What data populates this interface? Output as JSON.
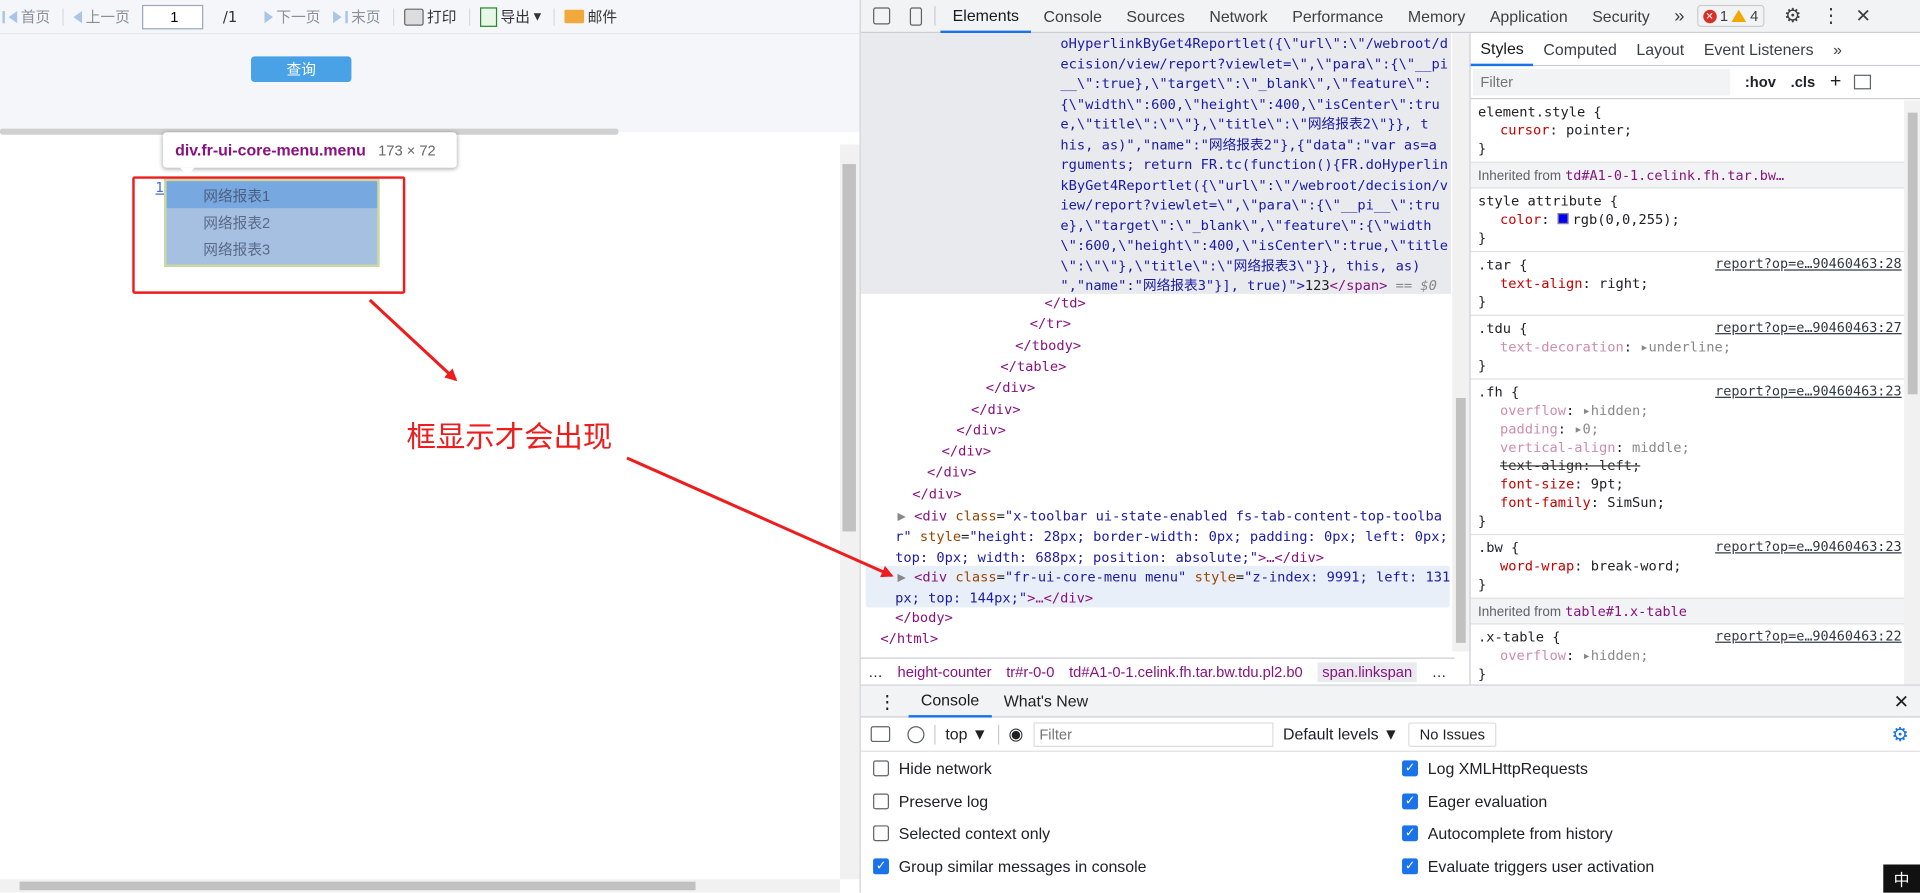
{
  "report_toolbar": {
    "first_page": "首页",
    "prev_page": "上一页",
    "page_value": "1",
    "page_total": "/1",
    "next_page": "下一页",
    "last_page": "末页",
    "print": "打印",
    "export": "导出",
    "mail": "邮件"
  },
  "query": {
    "button": "查询"
  },
  "tooltip": {
    "selector_tag": "div",
    "selector_class": ".fr-ui-core-menu.menu",
    "size": "173 × 72"
  },
  "report": {
    "cell_link": "1",
    "menu_items": [
      "网络报表1",
      "网络报表2",
      "网络报表3"
    ]
  },
  "annotation": {
    "text": "框显示才会出现"
  },
  "devtools": {
    "tabs": [
      "Elements",
      "Console",
      "Sources",
      "Network",
      "Performance",
      "Memory",
      "Application",
      "Security"
    ],
    "active_tab": "Elements",
    "more": "»",
    "errors": "1",
    "warnings": "4",
    "code_lines": [
      "oHyperlinkByGet4Reportlet({\\\"url\\\":\\\"/webroot/d",
      "ecision/view/report?viewlet=\\\",\\\"para\\\":{\\\"__pi",
      "__\\\":true},\\\"target\\\":\\\"_blank\\\",\\\"feature\\\":",
      "{\\\"width\\\":600,\\\"height\\\":400,\\\"isCenter\\\":tru",
      "e,\\\"title\\\":\\\"\\\"},\\\"title\\\":\\\"网络报表2\\\"}}, t",
      "his, as)\",\"name\":\"网络报表2\"},{\"data\":\"var as=a",
      "rguments; return FR.tc(function(){FR.doHyperlin",
      "kByGet4Reportlet({\\\"url\\\":\\\"/webroot/decision/v",
      "iew/report?viewlet=\\\",\\\"para\\\":{\\\"__pi__\\\":tru",
      "e},\\\"target\\\":\\\"_blank\\\",\\\"feature\\\":{\\\"width",
      "\\\":600,\\\"height\\\":400,\\\"isCenter\\\":true,\\\"title",
      "\\\":\\\"\\\"},\\\"title\\\":\\\"网络报表3\\\"}}, this, as)"
    ],
    "code_last": "\",\"name\":\"网络报表3\"}], true)\">",
    "code_last_text": "123",
    "code_last_close": "</span>",
    "code_last_eq": " == $0",
    "close_tags": [
      "</td>",
      "</tr>",
      "</tbody>",
      "</table>",
      "</div>",
      "</div>",
      "</div>",
      "</div>",
      "</div>",
      "</div>"
    ],
    "toolbar_div": {
      "open": "<div",
      "class_attr": "class",
      "class_val": "\"x-toolbar ui-state-enabled fs-tab-content-top-toolba",
      "line2": "r\"",
      "style_attr": "style",
      "style_val": "\"height: 28px; border-width: 0px; padding: 0px; left: 0px;",
      "line3": "top: 0px; width: 688px; position: absolute;\"",
      "ellipsis": ">…</div>"
    },
    "menu_div": {
      "open": "<div",
      "class_attr": "class",
      "class_val": "\"fr-ui-core-menu menu\"",
      "style_attr": "style",
      "style_val": "\"z-index: 9991; left: 131",
      "line2": "px; top: 144px;\"",
      "ellipsis": ">…</div>"
    },
    "body_close": "</body>",
    "html_close": "</html>",
    "breadcrumb": [
      "…",
      "height-counter",
      "tr#r-0-0",
      "td#A1-0-1.celink.fh.tar.bw.tdu.pl2.b0",
      "span.linkspan",
      "…"
    ],
    "styles_tabs": [
      "Styles",
      "Computed",
      "Layout",
      "Event Listeners",
      "»"
    ],
    "styles_filter_placeholder": "Filter",
    "hov": ":hov",
    "cls": ".cls",
    "rules": {
      "element_style": {
        "selector": "element.style {",
        "props": [
          {
            "name": "cursor",
            "value": "pointer;"
          }
        ]
      },
      "inherited1": {
        "label": "Inherited from",
        "target": "td#A1-0-1.celink.fh.tar.bw…"
      },
      "style_attr": {
        "selector": "style attribute {",
        "props": [
          {
            "name": "color",
            "value": "rgb(0,0,255);",
            "swatch": "#0000ff"
          }
        ]
      },
      "tar": {
        "selector": ".tar {",
        "src": "report?op=e…90460463:28",
        "props": [
          {
            "name": "text-align",
            "value": "right;"
          }
        ]
      },
      "tdu": {
        "selector": ".tdu {",
        "src": "report?op=e…90460463:27",
        "props": [
          {
            "name": "text-decoration",
            "value": "underline;"
          }
        ]
      },
      "fh": {
        "selector": ".fh {",
        "src": "report?op=e…90460463:23",
        "props": [
          {
            "name": "overflow",
            "value": "hidden;"
          },
          {
            "name": "padding",
            "value": "0;"
          },
          {
            "name": "vertical-align",
            "value": "middle;"
          },
          {
            "name": "text-align",
            "value": "left;"
          },
          {
            "name": "font-size",
            "value": "9pt;"
          },
          {
            "name": "font-family",
            "value": "SimSun;"
          }
        ]
      },
      "bw": {
        "selector": ".bw {",
        "src": "report?op=e…90460463:23",
        "props": [
          {
            "name": "word-wrap",
            "value": "break-word;"
          }
        ]
      },
      "inherited2": {
        "label": "Inherited from",
        "target": "table#1.x-table"
      },
      "xtable": {
        "selector": ".x-table {",
        "src": "report?op=e…90460463:22",
        "props": [
          {
            "name": "overflow",
            "value": "hidden;"
          }
        ]
      },
      "close": "}"
    },
    "drawer": {
      "tabs": [
        "Console",
        "What's New"
      ],
      "context": "top",
      "filter_placeholder": "Filter",
      "levels": "Default levels",
      "issues": "No Issues",
      "left_options": [
        {
          "label": "Hide network",
          "checked": false
        },
        {
          "label": "Preserve log",
          "checked": false
        },
        {
          "label": "Selected context only",
          "checked": false
        },
        {
          "label": "Group similar messages in console",
          "checked": true
        }
      ],
      "right_options": [
        {
          "label": "Log XMLHttpRequests",
          "checked": true
        },
        {
          "label": "Eager evaluation",
          "checked": true
        },
        {
          "label": "Autocomplete from history",
          "checked": true
        },
        {
          "label": "Evaluate triggers user activation",
          "checked": true
        }
      ]
    }
  },
  "ime": "中"
}
